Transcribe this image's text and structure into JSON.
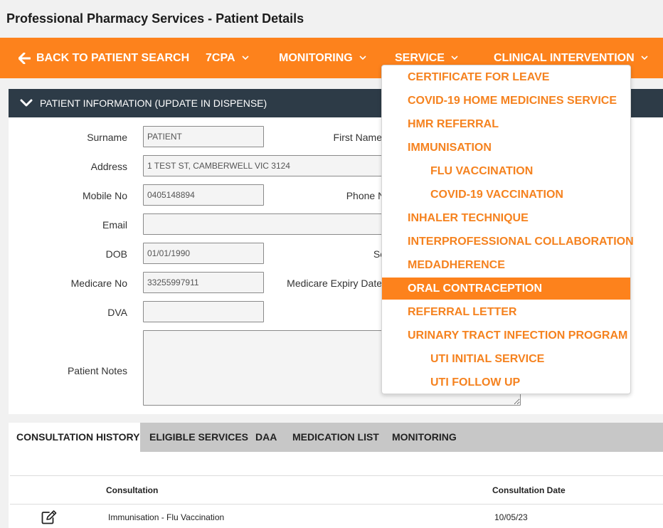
{
  "page": {
    "title": "Professional Pharmacy Services - Patient Details"
  },
  "colors": {
    "accent": "#fd821c",
    "panel_header": "#2d3b47"
  },
  "nav": {
    "back_label": "BACK TO PATIENT SEARCH",
    "items": [
      {
        "label": "7CPA"
      },
      {
        "label": "MONITORING"
      },
      {
        "label": "SERVICE"
      },
      {
        "label": "CLINICAL INTERVENTION"
      }
    ]
  },
  "patient_panel": {
    "header": "PATIENT INFORMATION (UPDATE IN DISPENSE)",
    "fields": {
      "surname": {
        "label": "Surname",
        "value": "PATIENT"
      },
      "first_name": {
        "label": "First Name"
      },
      "address": {
        "label": "Address",
        "value": "1 TEST ST, CAMBERWELL VIC 3124"
      },
      "mobile": {
        "label": "Mobile No",
        "value": "0405148894"
      },
      "phone": {
        "label": "Phone No"
      },
      "email": {
        "label": "Email",
        "value": ""
      },
      "dob": {
        "label": "DOB",
        "value": "01/01/1990"
      },
      "sex": {
        "label": "Sex"
      },
      "medicare": {
        "label": "Medicare No",
        "value": "33255997911"
      },
      "medicare_expiry": {
        "label": "Medicare Expiry Date"
      },
      "dva": {
        "label": "DVA",
        "value": ""
      },
      "notes": {
        "label": "Patient Notes",
        "value": ""
      }
    }
  },
  "service_menu": {
    "items": [
      {
        "label": "CERTIFICATE FOR LEAVE"
      },
      {
        "label": "COVID-19 HOME MEDICINES SERVICE"
      },
      {
        "label": "HMR REFERRAL"
      },
      {
        "label": "IMMUNISATION"
      },
      {
        "label": "FLU VACCINATION"
      },
      {
        "label": "COVID-19 VACCINATION"
      },
      {
        "label": "INHALER TECHNIQUE"
      },
      {
        "label": "INTERPROFESSIONAL COLLABORATION"
      },
      {
        "label": "MEDADHERENCE"
      },
      {
        "label": "ORAL CONTRACEPTION"
      },
      {
        "label": "REFERRAL LETTER"
      },
      {
        "label": "URINARY TRACT INFECTION PROGRAM"
      },
      {
        "label": "UTI INITIAL SERVICE"
      },
      {
        "label": "UTI FOLLOW UP"
      }
    ]
  },
  "tabs": [
    {
      "label": "CONSULTATION HISTORY"
    },
    {
      "label": "ELIGIBLE SERVICES"
    },
    {
      "label": "DAA"
    },
    {
      "label": "MEDICATION LIST"
    },
    {
      "label": "MONITORING"
    }
  ],
  "consultation_table": {
    "columns": [
      "Consultation",
      "Consultation Date"
    ],
    "rows": [
      {
        "consultation": "Immunisation - Flu Vaccination",
        "date": "10/05/23"
      }
    ]
  }
}
